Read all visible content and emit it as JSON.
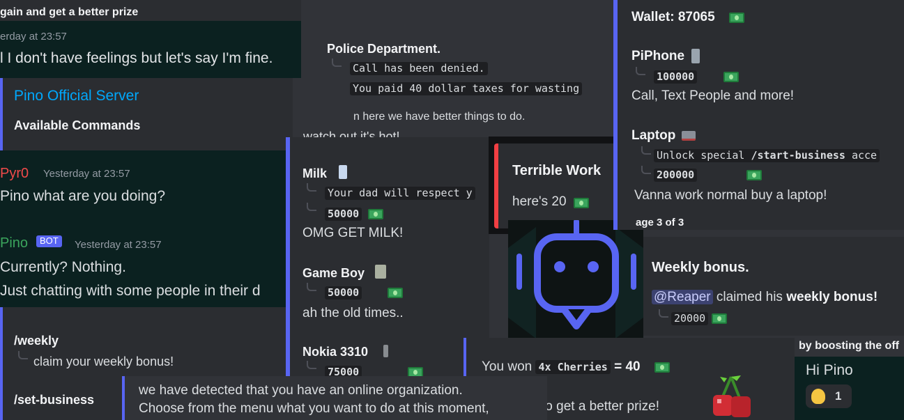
{
  "fragments": {
    "top_left": {
      "line1": "gain and get a better prize",
      "line2": "erday at 23:57",
      "line3": "l I don't have feelings but let's say I'm fine."
    },
    "commands_embed": {
      "title": "Pino Official Server",
      "subtitle": "Available Commands",
      "cmd_weekly": "/weekly",
      "cmd_weekly_desc": "claim your weekly bonus!",
      "cmd_set_business": "/set-business"
    },
    "chat": {
      "msg1_author": "Pyr0",
      "msg1_time": "Yesterday at 23:57",
      "msg1_text": "Pino what are you doing?",
      "msg2_author": "Pino",
      "msg2_badge": "BOT",
      "msg2_time": "Yesterday at 23:57",
      "msg2_line1": "Currently? Nothing.",
      "msg2_line2": "Just chatting with some people in their d"
    },
    "police": {
      "title": "Police Department.",
      "line1": "Call has been denied.",
      "line2": "You paid 40 dollar taxes for wasting",
      "line3": "n here we have better things to do.",
      "line4": "watch out it's hot!"
    },
    "shop": {
      "milk_name": "Milk",
      "milk_desc": "Your dad will respect y",
      "milk_price": "50000",
      "milk_text": "OMG GET MILK!",
      "gameboy_name": "Game Boy",
      "gameboy_price": "50000",
      "gameboy_text": "ah the old times..",
      "nokia_name": "Nokia 3310",
      "nokia_price": "75000"
    },
    "work": {
      "title": "Terrible Work",
      "text": "here's 20"
    },
    "wallet_embed": {
      "wallet": "Wallet: 87065",
      "piphone_name": "PiPhone",
      "piphone_price": "100000",
      "piphone_text": "Call, Text People and more!",
      "laptop_name": "Laptop",
      "laptop_desc_pre": "Unlock special",
      "laptop_desc_cmd": "/start-business",
      "laptop_desc_post": "acce",
      "laptop_price": "200000",
      "laptop_text": "Vanna work normal buy a laptop!",
      "page": "age 3 of 3"
    },
    "weekly_embed": {
      "title": "Weekly bonus.",
      "mention": "@Reaper",
      "text_mid": "claimed his",
      "text_bold": "weekly bonus!",
      "amount": "20000"
    },
    "slots": {
      "won_pre": "You won",
      "won_code": "4x Cherries",
      "won_post": "= 40",
      "prize": "to get a better prize!"
    },
    "business": {
      "line1": "we have detected that you have an online organization.",
      "line2": "Choose from the menu what you want to do at this moment,"
    },
    "boost": {
      "line": "by boosting the off"
    },
    "hi_msg": {
      "text": "Hi Pino",
      "reaction_count": "1"
    }
  },
  "colors": {
    "blurple": "#5865f2",
    "link_blue": "#00a8fc",
    "red": "#f23f43",
    "pyro_red": "#f04a4a",
    "pino_green": "#3ba55d"
  }
}
